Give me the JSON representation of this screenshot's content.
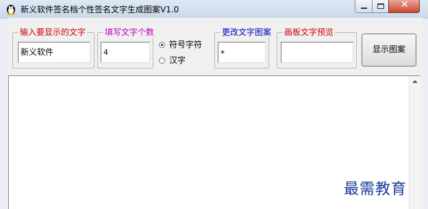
{
  "window": {
    "title": "新义软件签名档个性签名文字生成图案V1.0"
  },
  "groups": {
    "text_input": {
      "label": "输入要显示的文字",
      "value": "新义软件",
      "label_color": "#d00000"
    },
    "count_input": {
      "label": "填写文字个数",
      "value": "4",
      "label_color": "#c000c0"
    },
    "pattern_input": {
      "label": "更改文字图案",
      "value": "*",
      "label_color": "#0000c0"
    },
    "preview": {
      "label": "画板文字预览",
      "value": "",
      "label_color": "#d00000"
    }
  },
  "radios": [
    {
      "label": "符号字符",
      "checked": true
    },
    {
      "label": "汉字",
      "checked": false
    }
  ],
  "buttons": {
    "show_pattern": "显示图案"
  },
  "watermark": "最需教育"
}
